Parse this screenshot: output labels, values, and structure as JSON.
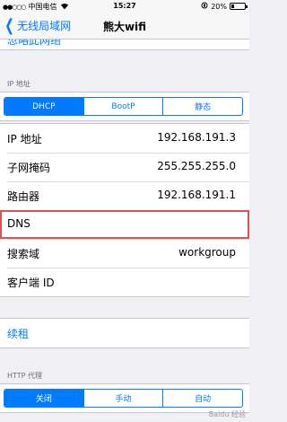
{
  "status_bar": {
    "carrier": "中国电信",
    "time": "15:27",
    "battery_text": "20%",
    "battery_level": 0.2
  },
  "nav": {
    "back_label": "无线局域网",
    "title": "熊大wifi"
  },
  "cut_row_text": "忽略此网络",
  "ip_section": {
    "header": "IP 地址",
    "segments": [
      "DHCP",
      "BootP",
      "静态"
    ],
    "selected": "DHCP",
    "rows": [
      {
        "label": "IP 地址",
        "value": "192.168.191.3"
      },
      {
        "label": "子网掩码",
        "value": "255.255.255.0"
      },
      {
        "label": "路由器",
        "value": "192.168.191.1"
      },
      {
        "label": "DNS",
        "value": ""
      },
      {
        "label": "搜索域",
        "value": "workgroup"
      },
      {
        "label": "客户端 ID",
        "value": ""
      }
    ]
  },
  "renew_label": "续租",
  "http_proxy": {
    "header": "HTTP 代理",
    "segments": [
      "关闭",
      "手动",
      "自动"
    ],
    "selected": "关闭"
  },
  "watermark": "Baidu 经验",
  "colors": {
    "accent": "#007aff",
    "highlight_border": "#d9534f",
    "background": "#efeff4"
  }
}
